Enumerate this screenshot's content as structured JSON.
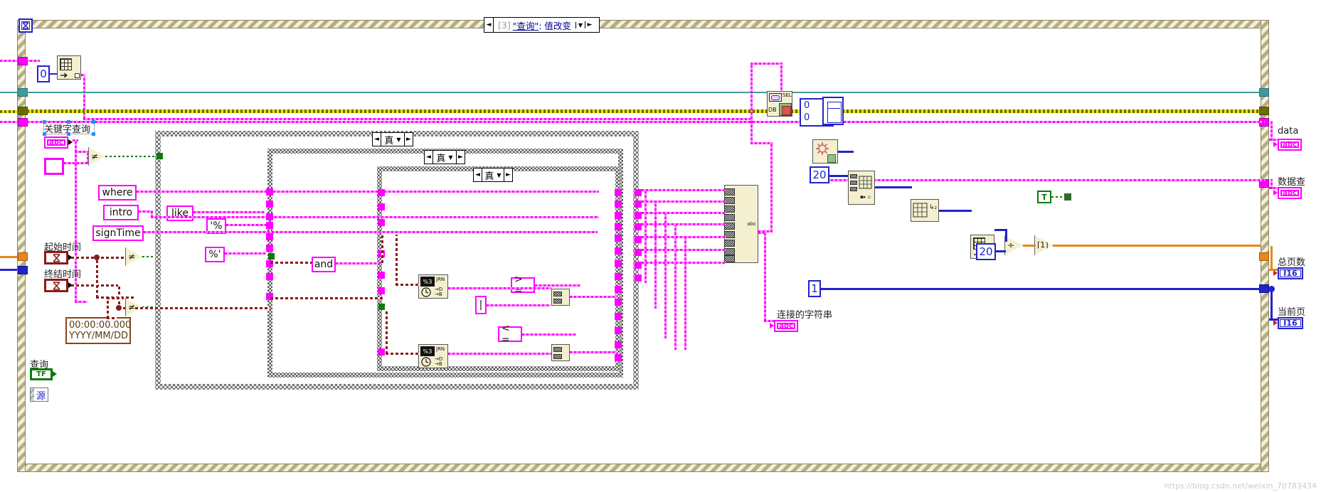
{
  "window": {
    "app": "LabVIEW Block Diagram",
    "event_case_title": {
      "index": "[3]",
      "name": "\"查询\"",
      "rest": ": 值改变",
      "left_arrow": "◄",
      "right_arrow": "►"
    }
  },
  "case_structures": [
    {
      "id": "case-outer",
      "selector": "真",
      "dropdown": "▼",
      "left_arrow": "◄",
      "right_arrow": "►"
    },
    {
      "id": "case-mid",
      "selector": "真",
      "dropdown": "▼",
      "left_arrow": "◄",
      "right_arrow": "►"
    },
    {
      "id": "case-inner",
      "selector": "真",
      "dropdown": "▼",
      "left_arrow": "◄",
      "right_arrow": "►"
    }
  ],
  "controls": {
    "keyword_query_label": "关键字查询",
    "keyword_query_type": "abc",
    "start_time_label": "起始时间",
    "end_time_label": "终结时间",
    "time_type": "⌛",
    "query_label": "查询",
    "query_type": "TF",
    "source_label": "源"
  },
  "indicators": {
    "data_label": "data",
    "data_type": "abc",
    "db_query_label": "数据查",
    "db_query_type": "abc",
    "total_pages_label": "总页数",
    "total_pages_type": "I16",
    "current_page_label": "当前页",
    "current_page_type": "I16",
    "concat_string_label": "连接的字符串",
    "concat_string_type": "abc"
  },
  "string_constants": {
    "where": "where",
    "intro": "intro",
    "sign_time": "signTime",
    "like": "like",
    "pct_open": "'%",
    "pct_close": "%'",
    "and": "and",
    "ge": "> =",
    "le": "< =",
    "pipe": "|"
  },
  "numeric_constants": {
    "zero_top": "0",
    "twenty_page": "20",
    "twenty_div": "20",
    "one_page": "1",
    "offset_zero": "0",
    "limit_zero": "0"
  },
  "timestamp_constant": {
    "line1": "00:00:00.000",
    "line2": "YYYY/MM/DD"
  },
  "nodes": {
    "not_equal": "≠",
    "divide": "÷",
    "round_up": "⌈1⌉",
    "db_select_label": "SEL",
    "db_label": "DB",
    "true_const": "T",
    "array_index": "▤",
    "format_into_string": "▤",
    "concat": "▤"
  },
  "watermark": "https://blog.csdn.net/weixin_70783434"
}
